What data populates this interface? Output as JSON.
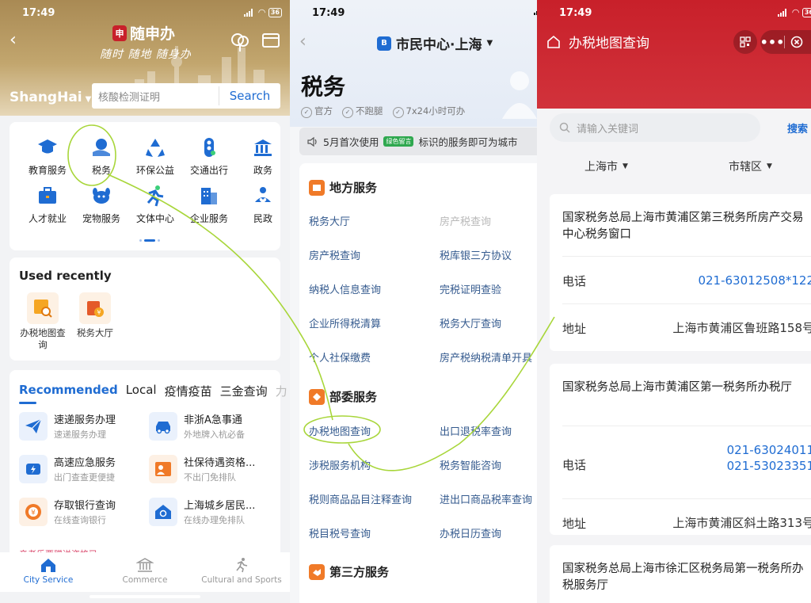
{
  "status": {
    "time": "17:49",
    "battery": "36"
  },
  "panel1": {
    "brand": "随申办",
    "slogan": "随时 随地 随身办",
    "city": "ShangHai",
    "search_placeholder": "核酸检测证明",
    "search_button": "Search",
    "grid": [
      {
        "label": "教育服务",
        "icon": "graduation-cap-icon",
        "color": "#1f6cd2"
      },
      {
        "label": "税务",
        "icon": "tax-hand-icon",
        "color": "#1f6cd2"
      },
      {
        "label": "环保公益",
        "icon": "recycle-icon",
        "color": "#1f6cd2"
      },
      {
        "label": "交通出行",
        "icon": "traffic-light-icon",
        "color": "#1f6cd2"
      },
      {
        "label": "政务",
        "icon": "government-building-icon",
        "color": "#1f6cd2"
      },
      {
        "label": "人才就业",
        "icon": "briefcase-icon",
        "color": "#1f6cd2"
      },
      {
        "label": "宠物服务",
        "icon": "dog-icon",
        "color": "#1f6cd2"
      },
      {
        "label": "文体中心",
        "icon": "runner-icon",
        "color": "#1f6cd2"
      },
      {
        "label": "企业服务",
        "icon": "office-building-icon",
        "color": "#1f6cd2"
      },
      {
        "label": "民政",
        "icon": "people-heart-icon",
        "color": "#1f6cd2"
      }
    ],
    "recent": {
      "title": "Used recently",
      "items": [
        {
          "label": "办税地图查询"
        },
        {
          "label": "税务大厅"
        }
      ]
    },
    "rec": {
      "tabs": [
        "Recommended",
        "Local",
        "疫情疫苗",
        "三金查询",
        "力"
      ],
      "items": [
        {
          "title": "速递服务办理",
          "sub": "速递服务办理",
          "icon": "paper-plane-icon",
          "color": "#1f6cd2"
        },
        {
          "title": "非浙A急事通",
          "sub": "外地牌入杭必备",
          "icon": "car-icon",
          "color": "#1f6cd2"
        },
        {
          "title": "高速应急服务",
          "sub": "出门查查更便捷",
          "icon": "lightning-car-icon",
          "color": "#1f6cd2"
        },
        {
          "title": "社保待遇资格...",
          "sub": "不出门免排队",
          "icon": "person-card-icon",
          "color": "#f07a28"
        },
        {
          "title": "存取银行查询",
          "sub": "在线查询银行",
          "icon": "bank-coin-icon",
          "color": "#f07a28"
        },
        {
          "title": "上海城乡居民...",
          "sub": "在线办理免排队",
          "icon": "house-search-icon",
          "color": "#1f6cd2"
        }
      ],
      "cutoff_text": "亲老乐票赠送资格已..."
    },
    "tabbar": [
      {
        "label": "City Service",
        "icon": "home-icon"
      },
      {
        "label": "Commerce",
        "icon": "bank-building-icon"
      },
      {
        "label": "Cultural and Sports",
        "icon": "runner-icon"
      }
    ]
  },
  "panel2": {
    "title": "市民中心·上海",
    "heading": "税务",
    "tags": [
      "官方",
      "不跑腿",
      "7x24小时可办"
    ],
    "notice": "5月首次使用",
    "notice_badge": "绿色留言",
    "notice_rest": "标识的服务即可为城市",
    "sections": [
      {
        "title": "地方服务",
        "links": [
          {
            "text": "税务大厅",
            "dim": false
          },
          {
            "text": "房产税查询",
            "dim": true
          },
          {
            "text": "房产税查询",
            "dim": false
          },
          {
            "text": "税库银三方协议",
            "dim": false
          },
          {
            "text": "纳税人信息查询",
            "dim": false
          },
          {
            "text": "完税证明查验",
            "dim": false
          },
          {
            "text": "企业所得税清算",
            "dim": false
          },
          {
            "text": "税务大厅查询",
            "dim": false
          },
          {
            "text": "个人社保缴费",
            "dim": false
          },
          {
            "text": "房产税纳税清单开具",
            "dim": false
          }
        ]
      },
      {
        "title": "部委服务",
        "links": [
          {
            "text": "办税地图查询",
            "dim": false
          },
          {
            "text": "出口退税率查询",
            "dim": false
          },
          {
            "text": "涉税服务机构",
            "dim": false
          },
          {
            "text": "税务智能咨询",
            "dim": false
          },
          {
            "text": "税则商品品目注释查询",
            "dim": false
          },
          {
            "text": "进出口商品税率查询",
            "dim": false
          },
          {
            "text": "税目税号查询",
            "dim": false
          },
          {
            "text": "办税日历查询",
            "dim": false
          }
        ]
      },
      {
        "title": "第三方服务",
        "links": []
      }
    ]
  },
  "panel3": {
    "title": "办税地图查询",
    "search_placeholder": "请输入关键词",
    "search_button": "搜索",
    "filter_city": "上海市",
    "filter_district": "市辖区",
    "offices": [
      {
        "name": "国家税务总局上海市黄浦区第三税务所房产交易中心税务窗口",
        "phone_label": "电话",
        "phones": [
          "021-63012508*122"
        ],
        "address_label": "地址",
        "address": "上海市黄浦区鲁班路158号"
      },
      {
        "name": "国家税务总局上海市黄浦区第一税务所办税厅",
        "phone_label": "电话",
        "phones": [
          "021-63024011",
          "021-53023351"
        ],
        "address_label": "地址",
        "address": "上海市黄浦区斜土路313号"
      },
      {
        "name": "国家税务总局上海市徐汇区税务局第一税务所办税服务厅",
        "phone_label": "",
        "phones": [],
        "address_label": "",
        "address": ""
      }
    ]
  },
  "colors": {
    "accent_blue": "#1f6cd2",
    "header_gold": "#b99a62",
    "header_red": "#c8202a",
    "annotation_green": "#a8d63a"
  }
}
